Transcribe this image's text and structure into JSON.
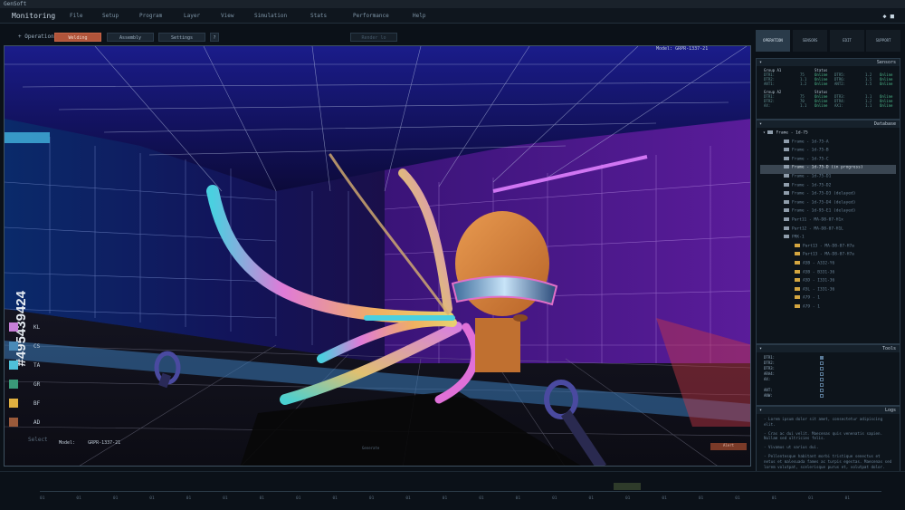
{
  "app": {
    "titlebar": "GenSoft",
    "title": "Monitoring",
    "menu": [
      "File",
      "Setup",
      "Program",
      "Layer",
      "View",
      "Simulation",
      "Stats",
      "Performance",
      "Help"
    ],
    "window_icons": "◆ ■"
  },
  "operation": {
    "label": "+ Operation:",
    "buttons": [
      "Welding",
      "Assembly",
      "Settings",
      "?"
    ],
    "active": "Welding",
    "ghost_button": "Render lo"
  },
  "viewport": {
    "model_label": "Model:",
    "model_value": "GRPR-1337-21",
    "legend": [
      {
        "code": "KL",
        "color": "#c77fd8"
      },
      {
        "code": "CS",
        "color": "#4a8ab8"
      },
      {
        "code": "TA",
        "color": "#4fc0d8"
      },
      {
        "code": "GR",
        "color": "#3a9a78"
      },
      {
        "code": "BF",
        "color": "#e0b040"
      },
      {
        "code": "AD",
        "color": "#9a5a3a"
      }
    ],
    "select_label": "Select",
    "bottom_model_label": "Model:",
    "bottom_model_value": "GRPR-1337-21",
    "center_label": "Generate",
    "indicator_label": "Alert",
    "watermark": "#495439424"
  },
  "panel": {
    "tabs": [
      "OPERATION",
      "SENSORS",
      "EDIT",
      "SUPPORT"
    ],
    "active_tab": "OPERATION",
    "sensors": {
      "title": "Sensors",
      "group_a": {
        "header": [
          "Group A1",
          "Status"
        ],
        "rows": [
          [
            "DTR1:",
            "75",
            "Online",
            "DTR5:",
            "1.2",
            "Online"
          ],
          [
            "DTR2:",
            "1.1",
            "Online",
            "DTR6:",
            "1.5",
            "Online"
          ],
          [
            "ANT1:",
            "1.2",
            "Online",
            "ANT2:",
            "1.5",
            "Online"
          ]
        ]
      },
      "group_b": {
        "header": [
          "Group A2",
          "Status"
        ],
        "rows": [
          [
            "DTR1:",
            "75",
            "Online",
            "DTR3:",
            "1.1",
            "Online"
          ],
          [
            "DTR2:",
            "70",
            "Online",
            "DTR4:",
            "1.2",
            "Online"
          ],
          [
            "AX:",
            "1.1",
            "Online",
            "AX1:",
            "1.1",
            "Online"
          ]
        ]
      }
    },
    "database": {
      "title": "Database",
      "root": "Frame - 1d-75",
      "items": [
        {
          "text": "Frame - 1d-75-A",
          "folder": "gray",
          "selected": false
        },
        {
          "text": "Frame - 1d-75-B",
          "folder": "gray",
          "selected": false
        },
        {
          "text": "Frame - 1d-75-C",
          "folder": "gray",
          "selected": false
        },
        {
          "text": "Frame - 1d-75-D (in progress)",
          "folder": "gray",
          "selected": true
        },
        {
          "text": "Frame - 1d-75-D1",
          "folder": "gray",
          "selected": false
        },
        {
          "text": "Frame - 1d-75-D2",
          "folder": "gray",
          "selected": false
        },
        {
          "text": "Frame - 1d-75-D3 (delayed)",
          "folder": "gray",
          "selected": false
        },
        {
          "text": "Frame - 1d-75-D4 (delayed)",
          "folder": "gray",
          "selected": false
        },
        {
          "text": "Frame - 1d-95-E1 (delayed)",
          "folder": "gray",
          "selected": false
        },
        {
          "text": "Part11 - MA-D8-07-H1x",
          "folder": "gray",
          "selected": false
        },
        {
          "text": "Part12 - MA-D8-07-H1L",
          "folder": "gray",
          "selected": false
        },
        {
          "text": "PRK-1",
          "folder": "gray",
          "selected": false
        },
        {
          "text": "Part13 - MA-D8-07-H7a",
          "folder": "yellow",
          "selected": false
        },
        {
          "text": "Part13 - MA-D8-07-H7a",
          "folder": "yellow",
          "selected": false
        },
        {
          "text": "A5B - A332-Y6",
          "folder": "yellow",
          "selected": false
        },
        {
          "text": "A5B - B331-36",
          "folder": "yellow",
          "selected": false
        },
        {
          "text": "A5D - I331-36",
          "folder": "yellow",
          "selected": false
        },
        {
          "text": "A5L - I331-36",
          "folder": "yellow",
          "selected": false
        },
        {
          "text": "A79 - 1",
          "folder": "yellow",
          "selected": false
        },
        {
          "text": "A79 - 1",
          "folder": "yellow",
          "selected": false
        }
      ]
    },
    "tools": {
      "title": "Tools",
      "rows": [
        {
          "label": "DTR1:",
          "on": true
        },
        {
          "label": "DTR2:",
          "on": false
        },
        {
          "label": "DTR3:",
          "on": false
        },
        {
          "label": "ARA4:",
          "on": false
        },
        {
          "label": "AX:",
          "on": false
        },
        {
          "label": "",
          "on": false
        },
        {
          "label": "ANT:",
          "on": false
        },
        {
          "label": "ANW:",
          "on": false
        }
      ]
    },
    "logs": {
      "title": "Logs",
      "paragraphs": [
        "- Lorem ipsum dolor sit amet, consectetur adipiscing elit.",
        "- Cras ac dui velit. Maecenas quis venenatis sapien. Nullam sed ultricies felis.",
        "- Vivamus ut varius dui.",
        "- Pellentesque habitant morbi tristique senectus et netus et malesuada fames ac turpis egestas. Maecenas sed lorem volutpat, scelerisque purus et, volutpat dolor."
      ]
    }
  },
  "timeline": {
    "labels": [
      "01",
      "01",
      "01",
      "01",
      "01",
      "01",
      "01",
      "01",
      "01",
      "01",
      "01",
      "01",
      "01",
      "01",
      "01",
      "01",
      "01",
      "01",
      "01",
      "01",
      "01",
      "01",
      "01"
    ]
  }
}
